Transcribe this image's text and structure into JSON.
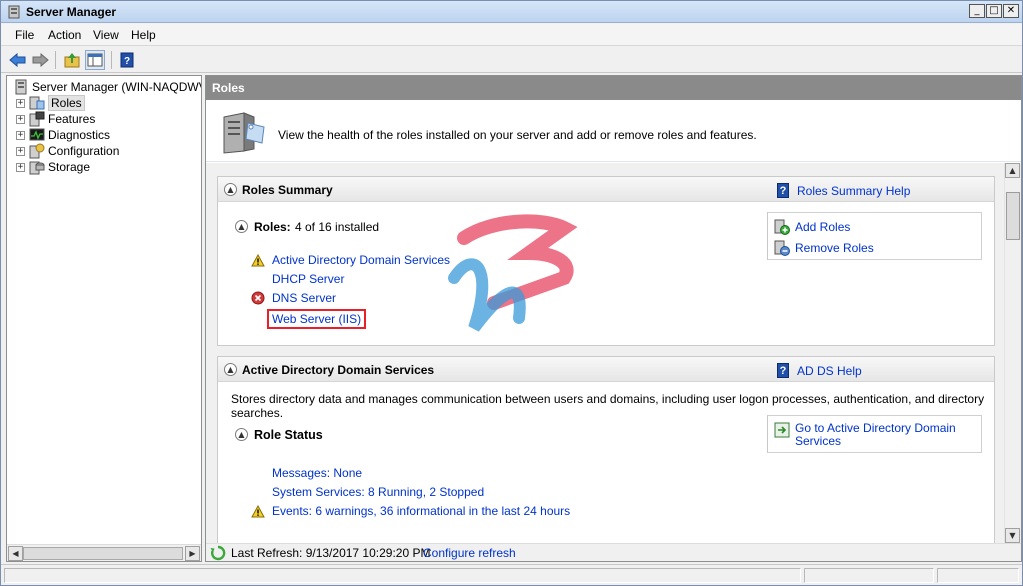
{
  "window": {
    "title": "Server Manager",
    "controls": [
      "_",
      "□",
      "✕"
    ]
  },
  "menu": {
    "file": "File",
    "action": "Action",
    "view": "View",
    "help": "Help"
  },
  "tree": {
    "root": "Server Manager (WIN-NAQDWVCIV",
    "items": [
      {
        "label": "Roles",
        "icon": "roles-icon",
        "selected": true
      },
      {
        "label": "Features",
        "icon": "features-icon"
      },
      {
        "label": "Diagnostics",
        "icon": "diagnostics-icon"
      },
      {
        "label": "Configuration",
        "icon": "configuration-icon"
      },
      {
        "label": "Storage",
        "icon": "storage-icon"
      }
    ]
  },
  "pane": {
    "header": "Roles",
    "description": "View the health of the roles installed on your server and add or remove roles and features."
  },
  "roles_summary": {
    "title": "Roles Summary",
    "help": "Roles Summary Help",
    "roles_label": "Roles:",
    "roles_count": "4 of 16 installed",
    "roles": [
      {
        "name": "Active Directory Domain Services",
        "status": "warning"
      },
      {
        "name": "DHCP Server",
        "status": "ok"
      },
      {
        "name": "DNS Server",
        "status": "error"
      },
      {
        "name": "Web Server (IIS)",
        "status": "ok",
        "highlighted": true
      }
    ],
    "add_roles": "Add Roles",
    "remove_roles": "Remove Roles"
  },
  "adds": {
    "title": "Active Directory Domain Services",
    "help": "AD DS Help",
    "description": "Stores directory data and manages communication between users and domains, including user logon processes, authentication, and directory searches.",
    "role_status": "Role Status",
    "goto_line1": "Go to Active Directory Domain",
    "goto_line2": "Services",
    "messages": "Messages: None",
    "services": "System Services: 8 Running, 2 Stopped",
    "events": "Events: 6 warnings, 36 informational in the last 24 hours"
  },
  "refresh": {
    "last": "Last Refresh: 9/13/2017 10:29:20 PM",
    "configure": "Configure refresh"
  },
  "colors": {
    "link": "#0033cc",
    "header_gray": "#8a8a8a",
    "highlight_red": "#e8202a"
  }
}
